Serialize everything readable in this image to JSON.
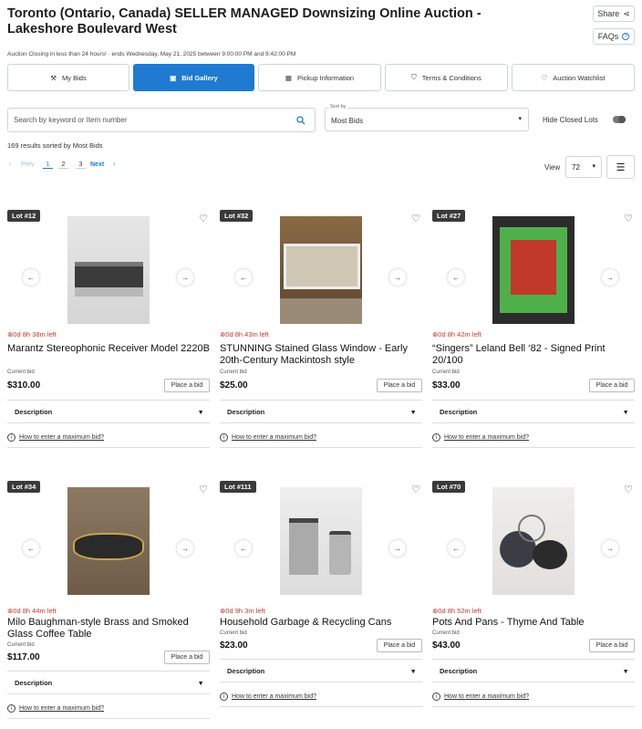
{
  "header": {
    "title": "Toronto (Ontario, Canada) SELLER MANAGED Downsizing Online Auction - Lakeshore Boulevard West",
    "share_label": "Share",
    "faqs_label": "FAQs",
    "closing_text": "Auction Closing in less than 24 hours! · ends Wednesday, May 21, 2025 between 9:00:00 PM and 9:42:00 PM"
  },
  "tabs": [
    {
      "label": "My Bids",
      "icon": "hammer-icon"
    },
    {
      "label": "Bid Gallery",
      "icon": "gallery-icon"
    },
    {
      "label": "Pickup Information",
      "icon": "calendar-icon"
    },
    {
      "label": "Terms & Conditions",
      "icon": "shield-icon"
    },
    {
      "label": "Auction Watchlist",
      "icon": "heart-icon"
    }
  ],
  "search": {
    "placeholder": "Search by keyword or Item number"
  },
  "sort": {
    "label": "Sort by",
    "value": "Most Bids"
  },
  "hide_closed": {
    "label": "Hide Closed Lots"
  },
  "results_text": "169 results sorted by Most Bids",
  "pagination": {
    "prev": "Prev",
    "pages": [
      "1",
      "2",
      "3"
    ],
    "next": "Next"
  },
  "view": {
    "label": "View",
    "value": "72"
  },
  "colors": {
    "accent": "#1f7ad1",
    "time_left": "#c0392b"
  },
  "lots": [
    {
      "lot": "Lot #12",
      "time_left": "0d 8h 38m left",
      "title": "Marantz Stereophonic Receiver Model 2220B",
      "current_bid_label": "Current bid",
      "price": "$310.00",
      "place_bid": "Place a bid",
      "description": "Description",
      "howto": "How to enter a maximum bid?"
    },
    {
      "lot": "Lot #32",
      "time_left": "0d 8h 43m left",
      "title": "STUNNING Stained Glass Window - Early 20th-Century Mackintosh style",
      "current_bid_label": "Current bid",
      "price": "$25.00",
      "place_bid": "Place a bid",
      "description": "Description",
      "howto": "How to enter a maximum bid?"
    },
    {
      "lot": "Lot #27",
      "time_left": "0d 8h 42m left",
      "title": "“Singers” Leland Bell ‘82 - Signed Print 20/100",
      "current_bid_label": "Current bid",
      "price": "$33.00",
      "place_bid": "Place a bid",
      "description": "Description",
      "howto": "How to enter a maximum bid?"
    },
    {
      "lot": "Lot #34",
      "time_left": "0d 8h 44m left",
      "title": "Milo Baughman-style Brass and Smoked Glass Coffee Table",
      "current_bid_label": "Current bid",
      "price": "$117.00",
      "place_bid": "Place a bid",
      "description": "Description",
      "howto": "How to enter a maximum bid?"
    },
    {
      "lot": "Lot #111",
      "time_left": "0d 9h 3m left",
      "title": "Household Garbage & Recycling Cans",
      "current_bid_label": "Current bid",
      "price": "$23.00",
      "place_bid": "Place a bid",
      "description": "Description",
      "howto": "How to enter a maximum bid?"
    },
    {
      "lot": "Lot #70",
      "time_left": "0d 8h 52m left",
      "title": "Pots And Pans - Thyme And Table",
      "current_bid_label": "Current bid",
      "price": "$43.00",
      "place_bid": "Place a bid",
      "description": "Description",
      "howto": "How to enter a maximum bid?"
    }
  ]
}
